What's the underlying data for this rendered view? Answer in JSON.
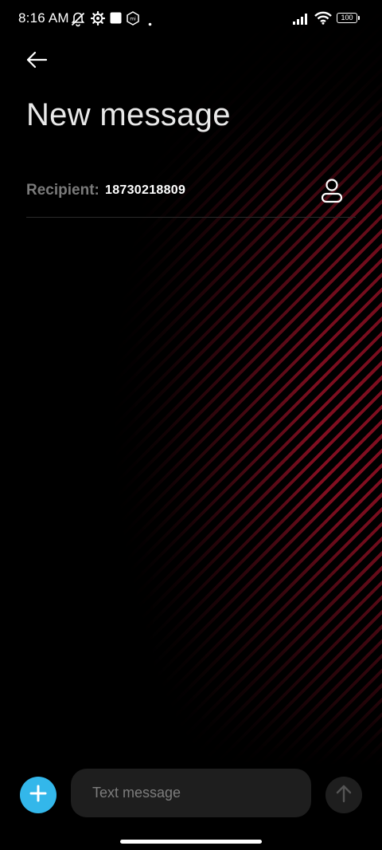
{
  "status_bar": {
    "time": "8:16 AM",
    "battery": "100",
    "icons_left": [
      "notifications-off-icon",
      "settings-gear-icon",
      "square-app-icon",
      "mi-app-icon",
      "dot-icon"
    ],
    "icons_right": [
      "signal-icon",
      "wifi-icon",
      "battery-icon"
    ]
  },
  "header": {
    "back_icon": "back-arrow-icon",
    "title": "New message"
  },
  "recipient": {
    "label": "Recipient:",
    "value": "18730218809",
    "contact_icon": "contact-person-icon"
  },
  "composer": {
    "add_icon": "plus-icon",
    "placeholder": "Text message",
    "value": "",
    "send_icon": "send-arrow-up-icon"
  },
  "colors": {
    "background": "#000000",
    "accent": "#33b7ea",
    "wallpaper_stripes": "#8a0f22",
    "input_bg": "#1e1e1e",
    "label_gray": "#7a7a7a"
  }
}
